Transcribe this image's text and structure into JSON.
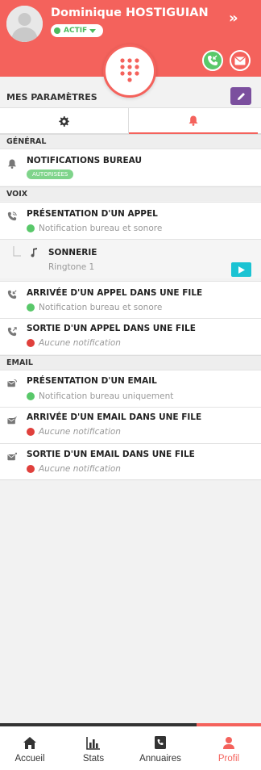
{
  "header": {
    "user_name": "Dominique HOSTIGUIAN",
    "status": "ACTIF",
    "expand_glyph": "»"
  },
  "settings": {
    "title": "MES PARAMÈTRES"
  },
  "sections": {
    "general": {
      "label": "GÉNÉRAL",
      "items": [
        {
          "title": "NOTIFICATIONS BUREAU",
          "badge": "AUTORISÉES"
        }
      ]
    },
    "voix": {
      "label": "VOIX",
      "items": [
        {
          "title": "PRÉSENTATION D'UN APPEL",
          "status": "Notification bureau et sonore"
        },
        {
          "title": "SONNERIE",
          "status": "Ringtone 1"
        },
        {
          "title": "ARRIVÉE D'UN APPEL DANS UNE FILE",
          "status": "Notification bureau et sonore"
        },
        {
          "title": "SORTIE D'UN APPEL DANS UNE FILE",
          "status": "Aucune notification"
        }
      ]
    },
    "email": {
      "label": "EMAIL",
      "items": [
        {
          "title": "PRÉSENTATION D'UN EMAIL",
          "status": "Notification bureau uniquement"
        },
        {
          "title": "ARRIVÉE D'UN EMAIL DANS UNE FILE",
          "status": "Aucune notification"
        },
        {
          "title": "SORTIE D'UN EMAIL DANS UNE FILE",
          "status": "Aucune notification"
        }
      ]
    }
  },
  "nav": {
    "items": [
      {
        "label": "Accueil",
        "icon": "home-icon"
      },
      {
        "label": "Stats",
        "icon": "stats-icon"
      },
      {
        "label": "Annuaires",
        "icon": "directory-icon"
      },
      {
        "label": "Profil",
        "icon": "profile-icon"
      }
    ],
    "active": "Profil"
  },
  "colors": {
    "accent": "#f4625c",
    "success": "#59c86a",
    "error": "#e0403c",
    "edit_purple": "#7b4f9e",
    "play_cyan": "#1bc3d3"
  }
}
